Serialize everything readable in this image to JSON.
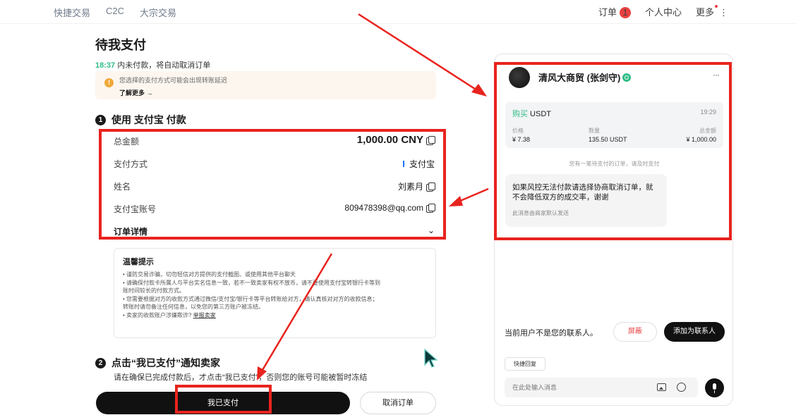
{
  "nav": {
    "left_items": [
      "快捷交易",
      "C2C",
      "大宗交易"
    ],
    "orders_label": "订单",
    "orders_badge": "1",
    "profile_label": "个人中心",
    "more_label": "更多"
  },
  "page": {
    "title": "待我支付",
    "timer_value": "18:37",
    "timer_text": " 内未付款，将自动取消订单",
    "notice_text": "您选择的支付方式可能会出现转账延迟",
    "notice_link": "了解更多 →"
  },
  "step1": {
    "num": "1",
    "text": "使用 支付宝 付款"
  },
  "payment": {
    "total_label": "总金额",
    "total_value": "1,000.00 CNY",
    "method_label": "支付方式",
    "method_value": "支付宝",
    "name_label": "姓名",
    "name_value": "刘素月",
    "account_label": "支付宝账号",
    "account_value": "809478398@qq.com",
    "details_label": "订单详情"
  },
  "tips": {
    "title": "温馨提示",
    "lines": [
      "• 谨防交易诈骗，切勿轻信对方提供的支付截图、或使用其他平台聊天",
      "• 请确保付款卡所属人与平台实名信息一致，若不一致卖家有权不放币，请不要使用支付宝转银行卡等到",
      "  账时间较长的付款方式。",
      "• 您需要根据对方的收款方式通过微信/支付宝/银行卡等平台转账给对方，请认真核对对方的收款信息；",
      "  转账时请勿备注任何信息，以免您的第三方账户被冻结。"
    ],
    "last_line_prefix": "• 卖家的收款账户涉嫌欺诈? ",
    "last_line_link": "举报卖家"
  },
  "step2": {
    "num": "2",
    "text": "点击“我已支付”通知卖家",
    "note": "请在确保已完成付款后，才点击“我已支付”，否则您的账号可能被暂时冻结"
  },
  "buttons": {
    "paid": "我已支付",
    "cancel": "取消订单"
  },
  "chat": {
    "merchant_name": "清风大商贸 (张剑守)",
    "more": "···",
    "order": {
      "side": "购买",
      "asset": " USDT",
      "time": "19:29",
      "price_label": "价格",
      "price_value": "¥ 7.38",
      "qty_label": "数量",
      "qty_value": "135.50 USDT",
      "total_label": "总金额",
      "total_value": "¥ 1,000.00"
    },
    "system_message": "您有一笔待支付的订单，请及时支付",
    "bubble_text": "如果风控无法付款请选择协商取消订单，就不会降低双方的成交率，谢谢",
    "bubble_footer": "此消息由商家默认发送",
    "contact_notice": "当前用户不是您的联系人。",
    "block_label": "屏蔽",
    "add_contact_label": "添加为联系人",
    "quick_reply_label": "快捷回复",
    "input_placeholder": "在此处输入消息"
  },
  "colors": {
    "accent_green": "#2ebd85",
    "annotation_red": "#e8231e",
    "badge_red": "#e94040"
  }
}
